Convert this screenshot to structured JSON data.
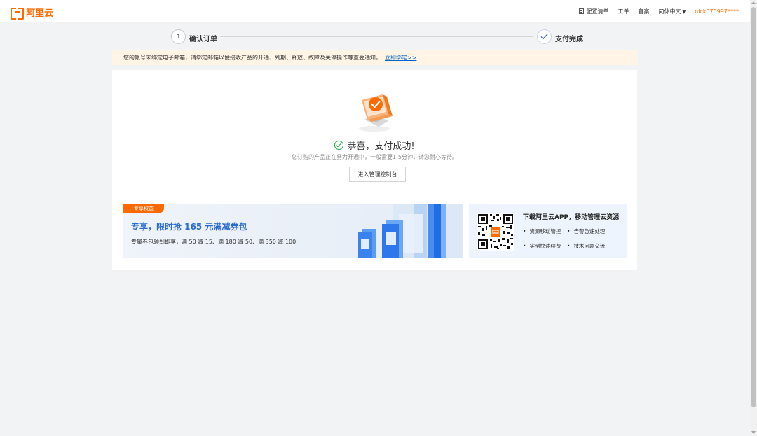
{
  "header": {
    "logo_text": "阿里云",
    "nav": {
      "config_list": "配置清单",
      "ticket": "工单",
      "icp": "备案",
      "language": "简体中文",
      "user": "nick070997****"
    }
  },
  "steps": [
    {
      "number": "1",
      "label": "确认订单"
    },
    {
      "label": "支付完成"
    }
  ],
  "notice": {
    "text": "您的帐号未绑定电子邮箱，请绑定邮箱以便接收产品的开通、到期、释放、故障及关停操作等重要通知。",
    "link": "立即绑定>>"
  },
  "result": {
    "title": "恭喜，支付成功!",
    "subtitle": "您订购的产品正在努力开通中，一般需要1-5分钟，请您耐心等待。",
    "button": "进入管理控制台"
  },
  "promo": {
    "tag": "专享权益",
    "title": "专享，限时抢 165 元满减券包",
    "desc": "专属券包领到即享，满 50 减 15、满 180 减 50、满 350 减 100"
  },
  "app": {
    "title": "下载阿里云APP，移动管理云资源",
    "features": [
      "资源移动管控",
      "告警急速处理",
      "实例快速续费",
      "技术问题交流"
    ]
  },
  "colors": {
    "brand": "#ff6a00",
    "success": "#1ea53f",
    "link": "#0064c8",
    "promo_title": "#2a6bd1"
  }
}
